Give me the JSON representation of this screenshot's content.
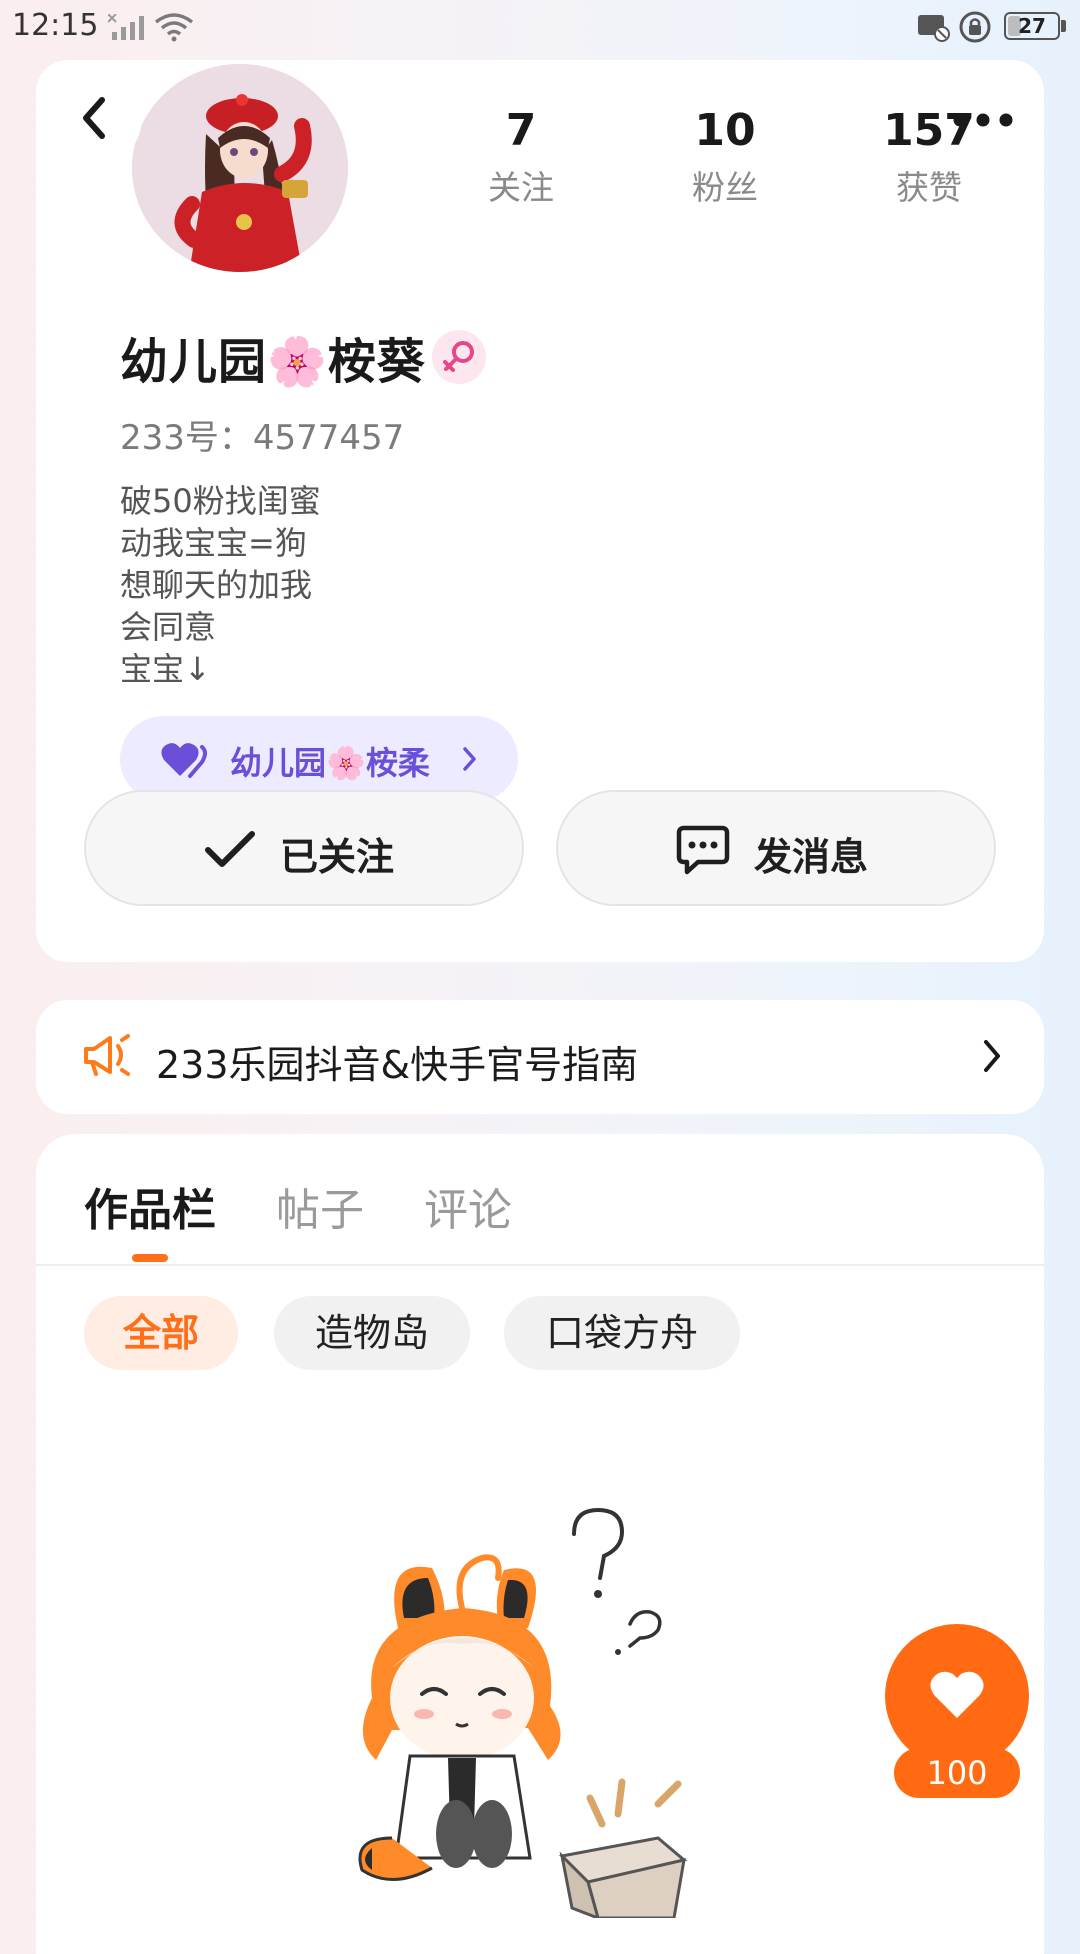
{
  "status_bar": {
    "time": "12:15",
    "battery": "27",
    "battery_level": 0.27
  },
  "profile": {
    "stats": [
      {
        "value": "7",
        "label": "关注"
      },
      {
        "value": "10",
        "label": "粉丝"
      },
      {
        "value": "157",
        "label": "获赞"
      }
    ],
    "name": "幼儿园🌸桉葵",
    "gender_icon": "female-symbol",
    "user_id": "233号：4577457",
    "bio_lines": [
      "破50粉找闺蜜",
      "动我宝宝=狗",
      "想聊天的加我",
      "会同意",
      "宝宝↓"
    ],
    "relation": {
      "icon": "purple-heart",
      "label": "幼儿园🌸桉柔"
    },
    "follow_button": "已关注",
    "message_button": "发消息"
  },
  "announcement": {
    "icon": "megaphone",
    "text": "233乐园抖音&快手官号指南"
  },
  "tabs": [
    {
      "label": "作品栏",
      "active": true
    },
    {
      "label": "帖子",
      "active": false
    },
    {
      "label": "评论",
      "active": false
    }
  ],
  "filters": [
    {
      "label": "全部",
      "active": true
    },
    {
      "label": "造物岛",
      "active": false
    },
    {
      "label": "口袋方舟",
      "active": false
    }
  ],
  "like_fab": {
    "icon": "heart",
    "count": "100"
  },
  "colors": {
    "accent": "#ff6a12",
    "relation_text": "#6b4fd8",
    "gender": "#e5488a"
  }
}
